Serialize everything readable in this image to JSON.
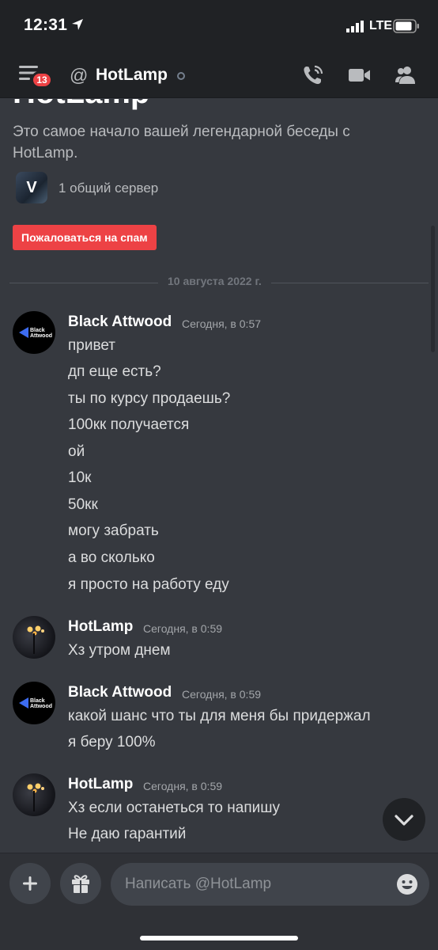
{
  "status_bar": {
    "time": "12:31",
    "network": "LTE"
  },
  "header": {
    "unread_badge": "13",
    "channel_title": "HotLamp",
    "icons": [
      "menu-icon",
      "at-icon",
      "voice-call-icon",
      "video-call-icon",
      "members-icon"
    ]
  },
  "intro": {
    "title": "HotLamp",
    "text": "Это самое начало вашей легендарной беседы с HotLamp.",
    "server_initial": "V",
    "mutual_servers": "1 общий сервер",
    "report_spam_label": "Пожаловаться на спам"
  },
  "date_divider": "10 августа 2022 г.",
  "messages": [
    {
      "author": "Black Attwood",
      "timestamp": "Сегодня, в 0:57",
      "avatar_text": [
        "Black",
        "Attwood"
      ],
      "lines": [
        "привет",
        "дп еще есть?",
        "ты по курсу продаешь?",
        "100кк получается",
        "ой",
        "10к",
        "50кк",
        "могу забрать",
        "а во сколько",
        "я просто на работу еду"
      ]
    },
    {
      "author": "HotLamp",
      "timestamp": "Сегодня, в 0:59",
      "lines": [
        "Хз утром днем"
      ]
    },
    {
      "author": "Black Attwood",
      "timestamp": "Сегодня, в 0:59",
      "avatar_text": [
        "Black",
        "Attwood"
      ],
      "lines": [
        "какой шанс что ты для меня бы придержал",
        "я беру 100%"
      ]
    },
    {
      "author": "HotLamp",
      "timestamp": "Сегодня, в 0:59",
      "lines": [
        "Хз если останеться то напишу",
        "Не даю гарантий"
      ]
    }
  ],
  "composer": {
    "placeholder": "Написать @HotLamp",
    "icons": [
      "plus-icon",
      "gift-icon",
      "emoji-icon",
      "chevron-down-icon"
    ]
  },
  "colors": {
    "background": "#36393f",
    "header": "#202225",
    "composer": "#2f3136",
    "danger": "#ed4245",
    "text": "#dcddde",
    "muted": "#a3a6aa"
  }
}
